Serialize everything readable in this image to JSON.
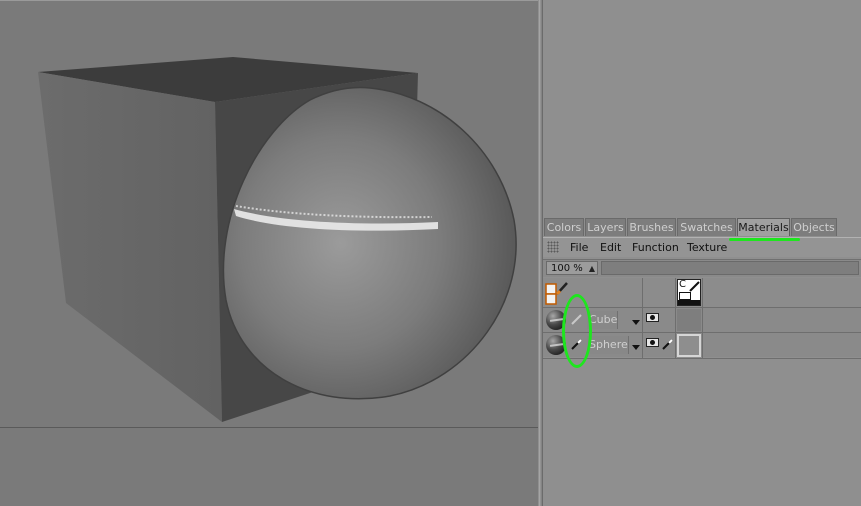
{
  "tabs": [
    {
      "label": "Colors",
      "active": false
    },
    {
      "label": "Layers",
      "active": false
    },
    {
      "label": "Brushes",
      "active": false
    },
    {
      "label": "Swatches",
      "active": false
    },
    {
      "label": "Materials",
      "active": true
    },
    {
      "label": "Objects",
      "active": false
    }
  ],
  "menu": [
    "File",
    "Edit",
    "Function",
    "Texture"
  ],
  "zoom": {
    "value": "100 %",
    "spin_icon": "spin-arrows-icon"
  },
  "materials": [
    {
      "name": "Cube",
      "icon": "material-sphere-icon",
      "pen_icon": "paintbrush-icon",
      "visibility_icon": "eye-icon"
    },
    {
      "name": "Sphere",
      "icon": "material-sphere-icon",
      "pen_icon": "paintbrush-icon",
      "visibility_icon": "eye-icon",
      "extra_icon": "paintbrush-icon"
    }
  ],
  "header_icons": {
    "left": "layer-stack-paint-icon",
    "right": "color-channel-icon",
    "right_label": "C"
  },
  "colors": {
    "highlight_mark": "#1ee61e",
    "active_tab": "#a0a0a0",
    "panel_bg": "#8f8f8f"
  }
}
